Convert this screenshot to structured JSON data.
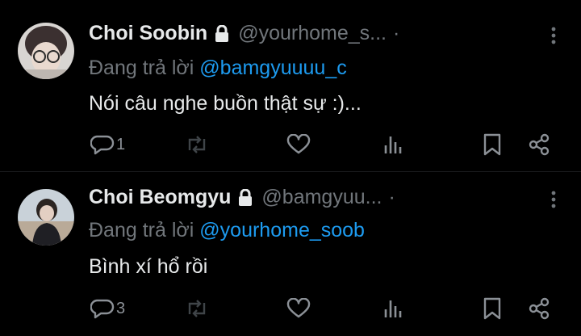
{
  "posts": [
    {
      "display_name": "Choi Soobin",
      "handle": "@yourhome_s...",
      "separator": "·",
      "reply_prefix": "Đang trả lời",
      "reply_to": "@bamgyuuuu_c",
      "text": "Nói câu nghe buồn thật sự :)...",
      "reply_count": "1",
      "locked": true
    },
    {
      "display_name": "Choi Beomgyu",
      "handle": "@bamgyuu...",
      "separator": "·",
      "reply_prefix": "Đang trả lời",
      "reply_to": "@yourhome_soob",
      "text": "Bình xí hổ rồi",
      "reply_count": "3",
      "locked": true
    }
  ],
  "icons": {
    "reply": "reply-icon",
    "repost": "repost-icon",
    "like": "heart-icon",
    "views": "views-icon",
    "bookmark": "bookmark-icon",
    "share": "share-icon",
    "lock": "lock-icon",
    "more": "more-icon"
  },
  "colors": {
    "background": "#000000",
    "text": "#e7e9ea",
    "muted": "#71767b",
    "mention": "#1d9bf0"
  }
}
